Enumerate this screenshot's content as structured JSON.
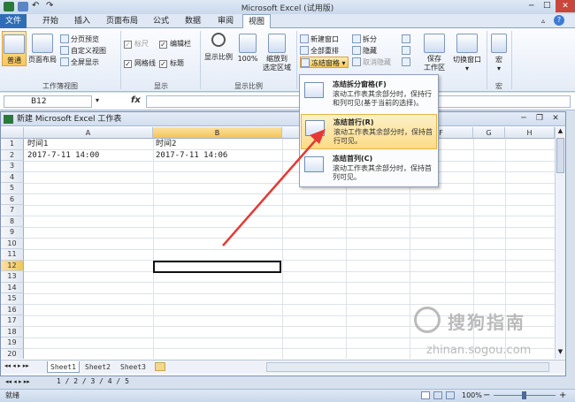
{
  "app": {
    "title": "Microsoft Excel (试用版)",
    "tabs": [
      "文件",
      "开始",
      "插入",
      "页面布局",
      "公式",
      "数据",
      "审阅",
      "视图"
    ],
    "active_tab": "视图"
  },
  "ribbon": {
    "workbook_views": {
      "normal": "普通",
      "page_layout": "页面布局",
      "page_break_preview": "分页预览",
      "custom_views": "自定义视图",
      "full_screen": "全屏显示",
      "group_label": "工作簿视图"
    },
    "show": {
      "ruler": "标尺",
      "formula_bar": "编辑栏",
      "gridlines": "网格线",
      "headings": "标题",
      "group_label": "显示"
    },
    "zoom": {
      "zoom": "显示比例",
      "hundred": "100%",
      "zoom_to_selection_1": "缩放到",
      "zoom_to_selection_2": "选定区域",
      "group_label": "显示比例"
    },
    "window": {
      "new_window": "新建窗口",
      "arrange_all": "全部重排",
      "freeze_panes": "冻结窗格",
      "split": "拆分",
      "hide": "隐藏",
      "unhide": "取消隐藏",
      "save_workspace_1": "保存",
      "save_workspace_2": "工作区",
      "switch_windows": "切换窗口"
    },
    "macros": {
      "macros": "宏",
      "group_label": "宏"
    }
  },
  "formula_bar": {
    "name_box": "B12",
    "fx": "fx",
    "content": ""
  },
  "workbook": {
    "title": "新建 Microsoft Excel 工作表",
    "columns": [
      "A",
      "B",
      "C",
      "D",
      "E",
      "F",
      "G",
      "H"
    ],
    "selected_column": "B",
    "selected_row": "12",
    "rows": [
      "1",
      "2",
      "3",
      "4",
      "5",
      "6",
      "7",
      "8",
      "9",
      "10",
      "11",
      "12",
      "13",
      "14",
      "15",
      "16",
      "17",
      "18",
      "19",
      "20"
    ],
    "cells": {
      "A1": "时间1",
      "B1": "时间2",
      "A2": "2017-7-11 14:00",
      "B2": "2017-7-11 14:06"
    },
    "sheets": [
      "Sheet1",
      "Sheet2",
      "Sheet3"
    ],
    "active_sheet": "Sheet1"
  },
  "freeze_menu": {
    "items": [
      {
        "title": "冻结拆分窗格(F)",
        "desc": "滚动工作表其余部分时，保持行和列可见(基于当前的选择)。"
      },
      {
        "title": "冻结首行(R)",
        "desc": "滚动工作表其余部分时，保持首行可见。",
        "highlighted": true
      },
      {
        "title": "冻结首列(C)",
        "desc": "滚动工作表其余部分时，保持首列可见。"
      }
    ]
  },
  "status_bar": {
    "ready": "就绪",
    "zoom": "100%",
    "page_nav": "1 / 2 / 3 / 4 / 5"
  },
  "watermark": {
    "text": "搜狗指南",
    "url": "zhinan.sogou.com"
  },
  "colors": {
    "file_tab": "#2f6db6",
    "highlight": "#fbdc86",
    "arrow": "#e53935"
  }
}
